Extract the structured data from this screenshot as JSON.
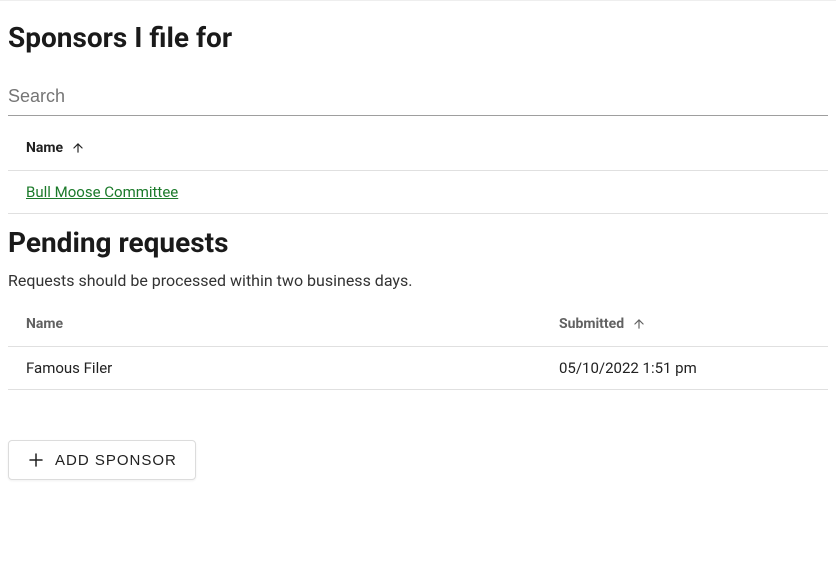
{
  "sponsors": {
    "title": "Sponsors I file for",
    "search_placeholder": "Search",
    "columns": {
      "name": "Name"
    },
    "rows": [
      {
        "name": "Bull Moose Committee"
      }
    ]
  },
  "pending": {
    "title": "Pending requests",
    "subtitle": "Requests should be processed within two business days.",
    "columns": {
      "name": "Name",
      "submitted": "Submitted"
    },
    "rows": [
      {
        "name": "Famous Filer",
        "submitted": "05/10/2022 1:51 pm"
      }
    ]
  },
  "actions": {
    "add_sponsor": "ADD SPONSOR"
  }
}
